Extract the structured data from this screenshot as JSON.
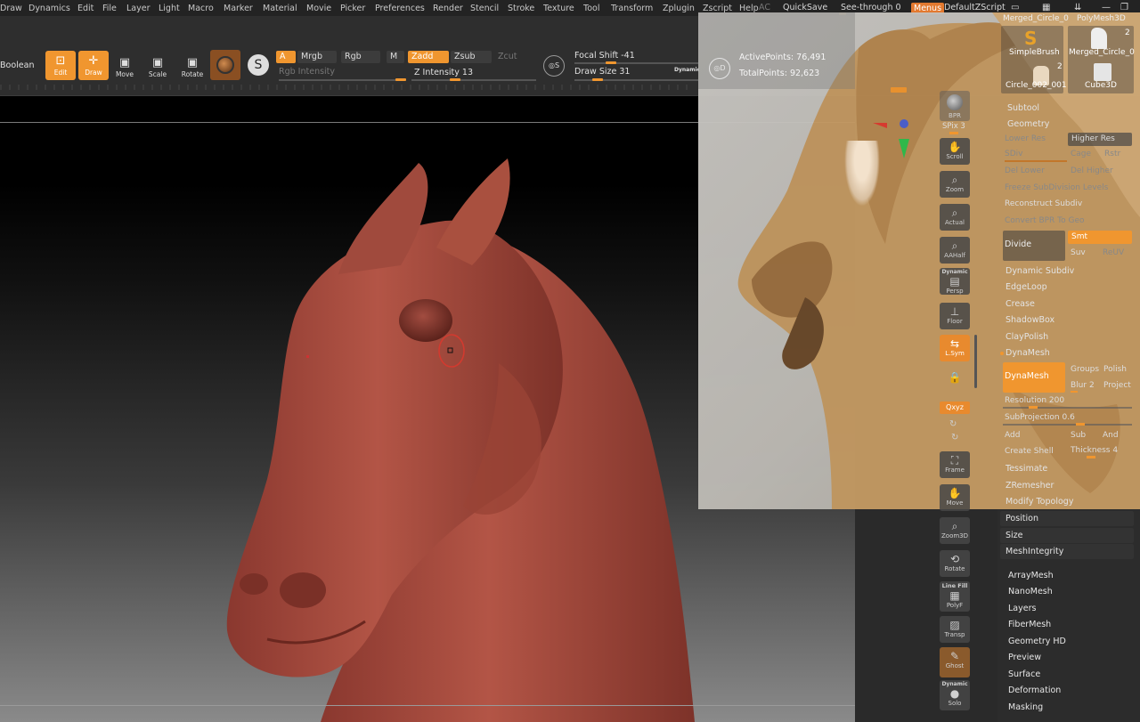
{
  "menu": {
    "items": [
      "Draw",
      "Dynamics",
      "Edit",
      "File",
      "Layer",
      "Light",
      "Macro",
      "Marker",
      "Material",
      "Movie",
      "Picker",
      "Preferences",
      "Render",
      "Stencil",
      "Stroke",
      "Texture",
      "Tool",
      "Transform",
      "Zplugin",
      "Zscript",
      "Help"
    ],
    "ac": "AC",
    "quicksave": "QuickSave",
    "see_through": "See-through  0",
    "menus": "Menus",
    "script": "DefaultZScript"
  },
  "toolbar": {
    "boolean": "Boolean",
    "edit": "Edit",
    "draw": "Draw",
    "move": "Move",
    "scale": "Scale",
    "rotate": "Rotate",
    "a": "A",
    "mrgb": "Mrgb",
    "rgb": "Rgb",
    "m": "M",
    "rgb_intensity": "Rgb Intensity",
    "zadd": "Zadd",
    "zsub": "Zsub",
    "zcut": "Zcut",
    "z_intensity": "Z Intensity 13",
    "focal_shift": "Focal Shift -41",
    "draw_size": "Draw Size 31",
    "dynamic": "Dynamic",
    "active_points": "ActivePoints: 76,491",
    "total_points": "TotalPoints: 92,623"
  },
  "shelf": {
    "bpr": "BPR",
    "spix": "SPix 3",
    "scroll": "Scroll",
    "zoom": "Zoom",
    "actual": "Actual",
    "aahalf": "AAHalf",
    "dynamic": "Dynamic",
    "persp": "Persp",
    "floor": "Floor",
    "lsym": "L.Sym",
    "xyz": "Qxyz",
    "frame": "Frame",
    "move": "Move",
    "zoom3d": "Zoom3D",
    "rotate": "Rotate",
    "line_fill": "Line Fill",
    "polyf": "PolyF",
    "transp": "Transp",
    "ghost": "Ghost",
    "solo_dynamic": "Dynamic",
    "solo": "Solo"
  },
  "tool": {
    "thumb1": "Merged_Circle_0",
    "thumb2": "PolyMesh3D",
    "simplebrush": "SimpleBrush",
    "merged": "Merged_Circle_0",
    "circle": "Circle_002_001",
    "cube": "Cube3D",
    "count2a": "2",
    "count2b": "2",
    "subtool": "Subtool",
    "geometry": "Geometry",
    "lower_res": "Lower Res",
    "higher_res": "Higher Res",
    "sdiv": "SDiv",
    "cage": "Cage",
    "rstr": "Rstr",
    "del_lower": "Del Lower",
    "del_higher": "Del Higher",
    "freeze": "Freeze SubDivision Levels",
    "reconstruct": "Reconstruct Subdiv",
    "convert_bpr": "Convert BPR To Geo",
    "divide": "Divide",
    "smt": "Smt",
    "suv": "Suv",
    "reuv": "ReUV",
    "dynamic_subdiv": "Dynamic Subdiv",
    "edgeloop": "EdgeLoop",
    "crease": "Crease",
    "shadowbox": "ShadowBox",
    "claypolish": "ClayPolish",
    "dynamesh_header": "DynaMesh",
    "dynamesh_btn": "DynaMesh",
    "groups": "Groups",
    "polish": "Polish",
    "blur": "Blur 2",
    "project": "Project",
    "resolution": "Resolution 200",
    "subprojection": "SubProjection 0.6",
    "add": "Add",
    "sub": "Sub",
    "and": "And",
    "create_shell": "Create Shell",
    "thickness": "Thickness 4",
    "tessimate": "Tessimate",
    "zremesher": "ZRemesher",
    "modify_topology": "Modify Topology",
    "position": "Position",
    "size": "Size",
    "meshintegrity": "MeshIntegrity"
  },
  "lower": [
    "ArrayMesh",
    "NanoMesh",
    "Layers",
    "FiberMesh",
    "Geometry HD",
    "Preview",
    "Surface",
    "Deformation",
    "Masking"
  ],
  "colors": {
    "accent": "#f0962f",
    "clay": "#a3483c"
  }
}
